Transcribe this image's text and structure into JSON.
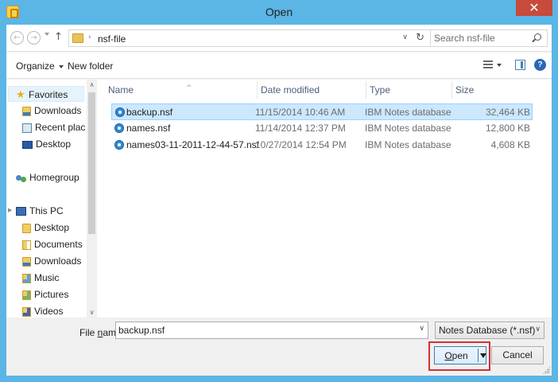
{
  "window": {
    "title": "Open",
    "close_glyph": "✕"
  },
  "address": {
    "back_glyph": "←",
    "forward_glyph": "→",
    "up_glyph": "↑",
    "chevron_glyph": "›",
    "crumb": "nsf-file",
    "drop_glyph": "∨",
    "refresh_glyph": "↻"
  },
  "search": {
    "placeholder": "Search nsf-file"
  },
  "toolbar": {
    "organize_label": "Organize",
    "new_folder_label": "New folder",
    "help_glyph": "?"
  },
  "nav": {
    "items": [
      {
        "label": "Favorites",
        "icon": "star-icon"
      },
      {
        "label": "Downloads",
        "icon": "downloads-folder-icon"
      },
      {
        "label": "Recent places",
        "icon": "recent-places-icon"
      },
      {
        "label": "Desktop",
        "icon": "desktop-icon"
      },
      {
        "label": "Homegroup",
        "icon": "homegroup-icon"
      },
      {
        "label": "This PC",
        "icon": "computer-icon"
      },
      {
        "label": "Desktop",
        "icon": "desktop-folder-icon"
      },
      {
        "label": "Documents",
        "icon": "documents-folder-icon"
      },
      {
        "label": "Downloads",
        "icon": "downloads-folder-icon"
      },
      {
        "label": "Music",
        "icon": "music-folder-icon"
      },
      {
        "label": "Pictures",
        "icon": "pictures-folder-icon"
      },
      {
        "label": "Videos",
        "icon": "videos-folder-icon"
      }
    ],
    "expand_glyph": "▶",
    "scroll_up_glyph": "∧",
    "scroll_down_glyph": "∨"
  },
  "columns": {
    "name": "Name",
    "date": "Date modified",
    "type": "Type",
    "size": "Size",
    "sort_glyph": "^"
  },
  "files": [
    {
      "name": "backup.nsf",
      "date": "11/15/2014 10:46 AM",
      "type": "IBM Notes database",
      "size": "32,464 KB"
    },
    {
      "name": "names.nsf",
      "date": "11/14/2014 12:37 PM",
      "type": "IBM Notes database",
      "size": "12,800 KB"
    },
    {
      "name": "names03-11-2011-12-44-57.nsf",
      "date": "10/27/2014 12:54 PM",
      "type": "IBM Notes database",
      "size": "4,608 KB"
    }
  ],
  "file_name": {
    "label_pre": "File ",
    "label_ul": "n",
    "label_post": "ame:",
    "value": "backup.nsf",
    "drop_glyph": "∨"
  },
  "filter": {
    "selected": "Notes Database (*.nsf)",
    "drop_glyph": "∨"
  },
  "buttons": {
    "open_ul": "O",
    "open_rest": "pen",
    "cancel": "Cancel"
  },
  "colors": {
    "titlebar": "#5bb5e5",
    "close": "#c74a3b",
    "selection": "#cce8ff",
    "highlight_frame": "#d33131"
  }
}
